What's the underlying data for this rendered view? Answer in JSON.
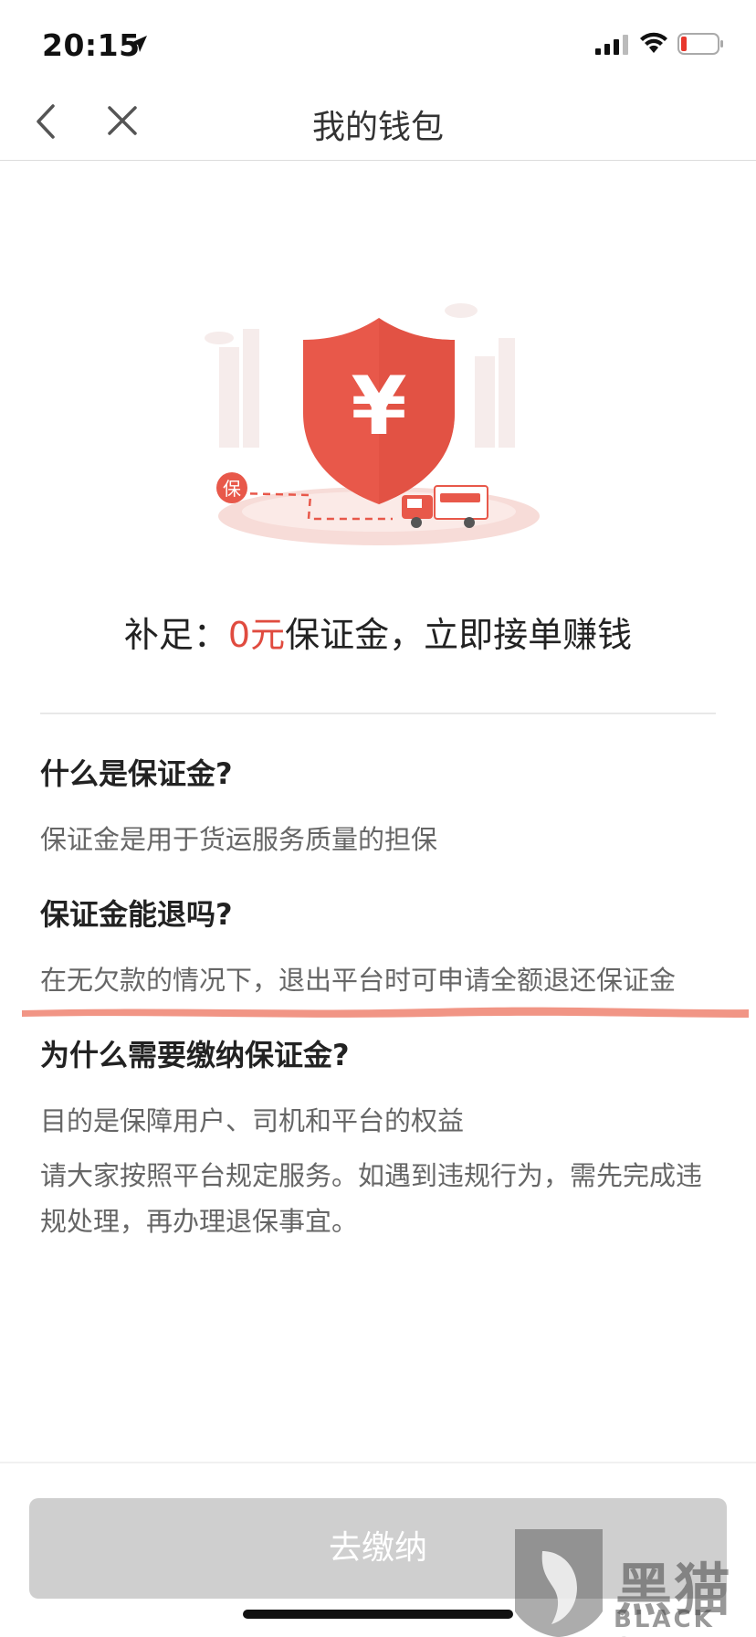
{
  "status_bar": {
    "time": "20:15",
    "icons": [
      "location-arrow-icon",
      "cellular-signal-icon",
      "wifi-icon",
      "battery-low-icon"
    ]
  },
  "nav": {
    "title": "我的钱包",
    "back_icon": "chevron-left-icon",
    "close_icon": "close-icon"
  },
  "hero": {
    "shield_symbol": "¥",
    "badge_text": "保",
    "colors": {
      "shield": "#e8584a",
      "accent": "#f08a80"
    }
  },
  "headline": {
    "prefix": "补足：",
    "amount": "0元",
    "suffix": "保证金，立即接单赚钱",
    "amount_color": "#e04b3f"
  },
  "faq": [
    {
      "question": "什么是保证金?",
      "answer": "保证金是用于货运服务质量的担保"
    },
    {
      "question": "保证金能退吗?",
      "answer": "在无欠款的情况下，退出平台时可申请全额退还保证金"
    },
    {
      "question": "为什么需要缴纳保证金?",
      "answer": "目的是保障用户、司机和平台的权益"
    }
  ],
  "notice": "请大家按照平台规定服务。如遇到违规行为，需先完成违规处理，再办理退保事宜。",
  "pay_button": {
    "label": "去缴纳",
    "state": "disabled"
  },
  "watermark": {
    "brand": "黑猫",
    "sub": "BLACK CAT"
  }
}
